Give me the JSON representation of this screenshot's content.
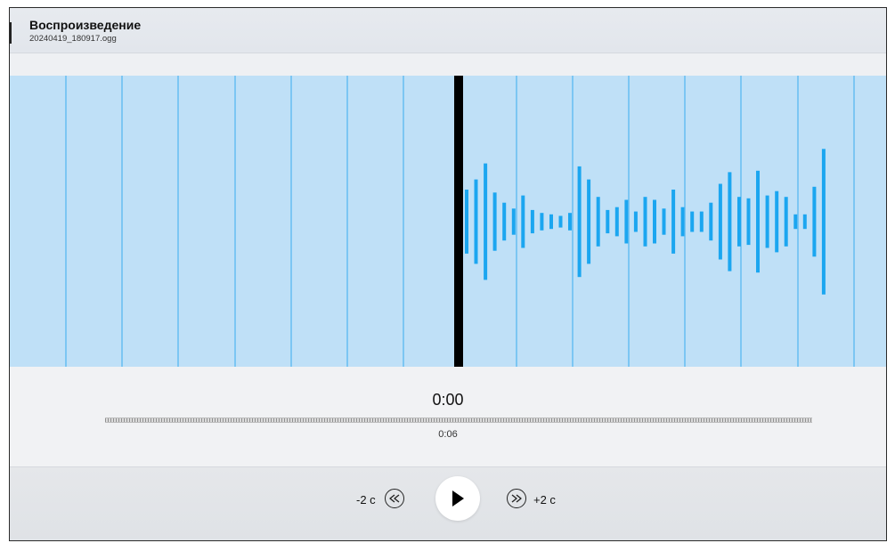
{
  "header": {
    "title": "Воспроизведение",
    "filename": "20240419_180917.ogg"
  },
  "playback": {
    "current_time": "0:00",
    "total_time": "0:06",
    "progress": 0
  },
  "controls": {
    "back_label": "-2 с",
    "forward_label": "+2 с",
    "back_icon": "rewind-icon",
    "forward_icon": "fast-forward-icon",
    "play_icon": "play-icon"
  },
  "colors": {
    "waveform_background": "#bfe0f7",
    "waveform_bars": "#1ba6f0",
    "grid_lines": "#7cc6f3",
    "playhead": "#000000"
  },
  "waveform": {
    "amplitudes": [
      0.22,
      0.29,
      0.4,
      0.2,
      0.13,
      0.09,
      0.18,
      0.08,
      0.06,
      0.05,
      0.04,
      0.06,
      0.38,
      0.29,
      0.17,
      0.08,
      0.1,
      0.15,
      0.07,
      0.17,
      0.15,
      0.09,
      0.22,
      0.1,
      0.07,
      0.07,
      0.13,
      0.26,
      0.34,
      0.17,
      0.16,
      0.35,
      0.18,
      0.21,
      0.17,
      0.05,
      0.05,
      0.24,
      0.5
    ]
  }
}
